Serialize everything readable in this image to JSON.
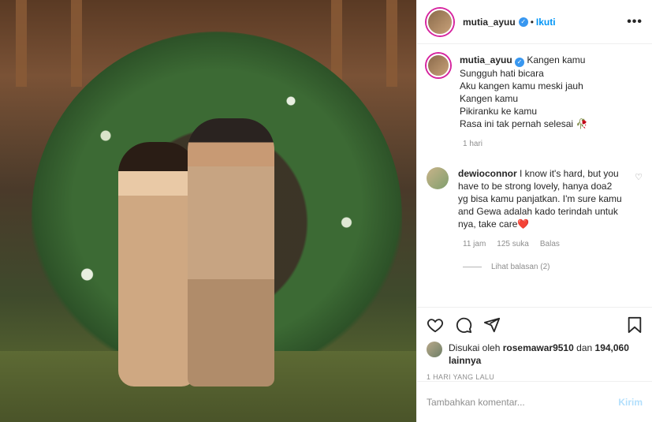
{
  "post": {
    "username": "mutia_ayuu",
    "verified_badge": "✓",
    "dot": "•",
    "follow_label": "Ikuti",
    "more_label": "•••"
  },
  "caption": {
    "username": "mutia_ayuu",
    "lines": [
      "Kangen kamu",
      "Sungguh hati bicara",
      "Aku kangen kamu meski jauh",
      "Kangen kamu",
      "Pikiranku ke kamu",
      "Rasa ini tak pernah selesai"
    ],
    "emoji": "🥀",
    "time": "1 hari"
  },
  "comment": {
    "username": "dewioconnor",
    "text": "I know it's hard, but you have to be strong lovely, hanya doa2 yg bisa kamu panjatkan. I'm sure kamu and Gewa adalah kado terindah untuk nya, take care",
    "emoji": "❤️",
    "time": "11 jam",
    "likes": "125 suka",
    "reply_label": "Balas",
    "view_replies": "Lihat balasan (2)"
  },
  "likes": {
    "prefix": "Disukai oleh",
    "user": "rosemawar9510",
    "connector": "dan",
    "count": "194,060 lainnya"
  },
  "post_date": "1 HARI YANG LALU",
  "add_comment": {
    "placeholder": "Tambahkan komentar...",
    "post_label": "Kirim"
  },
  "icons": {
    "like": "heart-icon",
    "comment": "comment-bubble-icon",
    "share": "paper-plane-icon",
    "save": "bookmark-icon"
  },
  "colors": {
    "accent": "#0095f6",
    "verified": "#3897f0",
    "muted": "#8e8e8e"
  }
}
